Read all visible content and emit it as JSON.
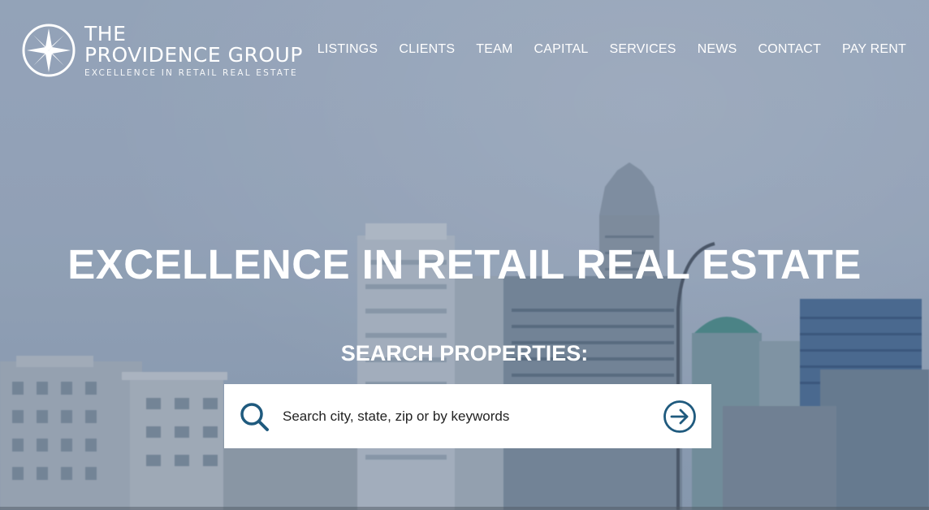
{
  "brand": {
    "line1": "THE",
    "line2": "PROVIDENCE GROUP",
    "tagline": "EXCELLENCE IN RETAIL REAL ESTATE",
    "icon": "compass-icon"
  },
  "nav": {
    "items": [
      {
        "label": "LISTINGS"
      },
      {
        "label": "CLIENTS"
      },
      {
        "label": "TEAM"
      },
      {
        "label": "CAPITAL"
      },
      {
        "label": "SERVICES"
      },
      {
        "label": "NEWS"
      },
      {
        "label": "CONTACT"
      },
      {
        "label": "PAY RENT"
      }
    ]
  },
  "hero": {
    "headline": "EXCELLENCE IN RETAIL REAL ESTATE",
    "search_label": "SEARCH PROPERTIES:"
  },
  "search": {
    "placeholder": "Search city, state, zip or by keywords",
    "value": "",
    "icon": "search-icon",
    "submit_icon": "arrow-right-circle-icon"
  },
  "colors": {
    "accent": "#1f5a7e",
    "text_on_hero": "#ffffff"
  }
}
